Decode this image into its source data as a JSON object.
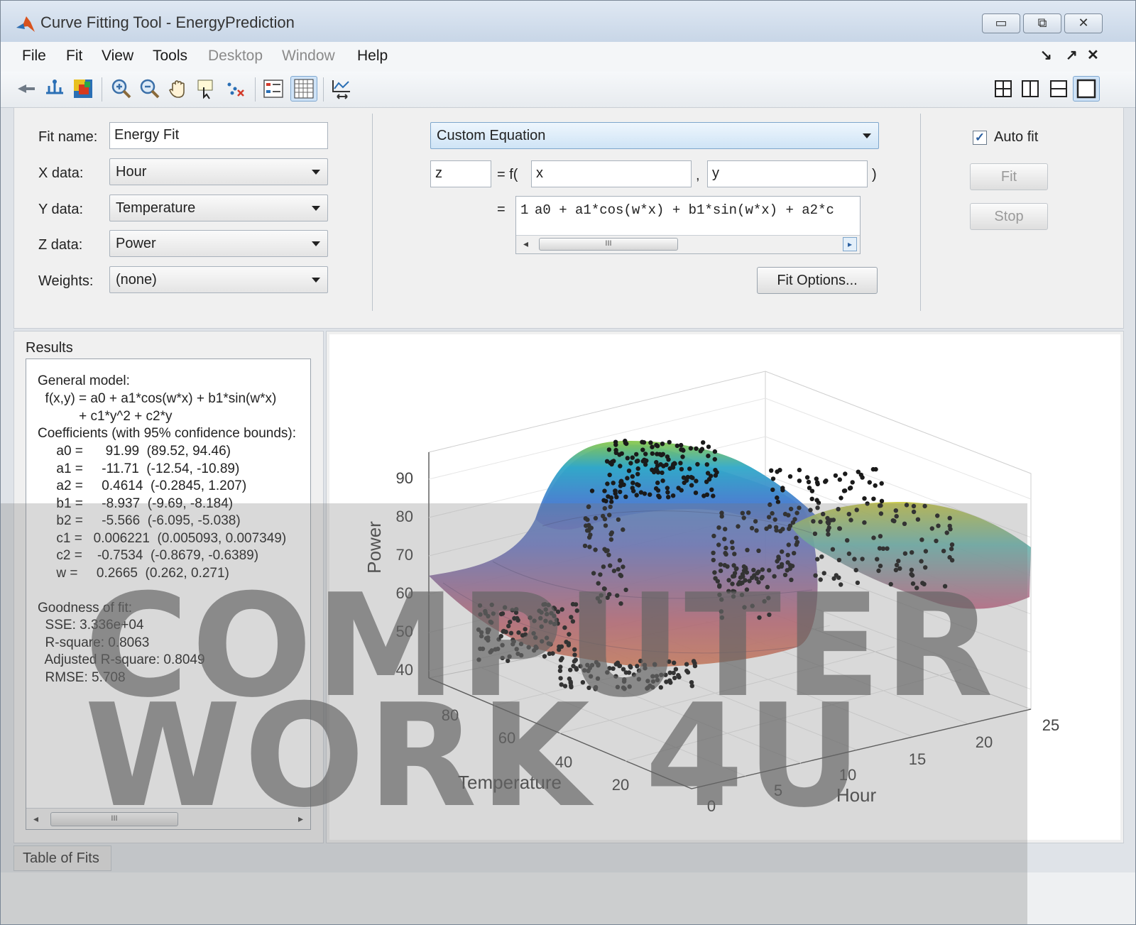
{
  "window": {
    "title": "Curve Fitting Tool - EnergyPrediction"
  },
  "menu": [
    "File",
    "Fit",
    "View",
    "Tools",
    "Desktop",
    "Window",
    "Help"
  ],
  "menu_disabled": [
    "Desktop",
    "Window"
  ],
  "fit": {
    "name_label": "Fit name:",
    "name_value": "Energy Fit",
    "x_label": "X data:",
    "x_value": "Hour",
    "y_label": "Y data:",
    "y_value": "Temperature",
    "z_label": "Z data:",
    "z_value": "Power",
    "weights_label": "Weights:",
    "weights_value": "(none)",
    "model_type": "Custom Equation",
    "z_var": "z",
    "eq_prefix": "= f(",
    "x_var": "x",
    "comma": ",",
    "y_var": "y",
    "close_paren": ")",
    "equals": "=",
    "line_number": "1",
    "equation": "a0 + a1*cos(w*x) + b1*sin(w*x) + a2*c",
    "scroll_grip": "III",
    "fit_options": "Fit Options...",
    "auto_fit_label": "Auto fit",
    "auto_fit_checked": true,
    "fit_button": "Fit",
    "stop_button": "Stop"
  },
  "results": {
    "title": "Results",
    "lines": [
      "General model:",
      "  f(x,y) = a0 + a1*cos(w*x) + b1*sin(w*x)",
      "           + c1*y^2 + c2*y",
      "Coefficients (with 95% confidence bounds):",
      "     a0 =      91.99  (89.52, 94.46)",
      "     a1 =     -11.71  (-12.54, -10.89)",
      "     a2 =     0.4614  (-0.2845, 1.207)",
      "     b1 =     -8.937  (-9.69, -8.184)",
      "     b2 =     -5.566  (-6.095, -5.038)",
      "     c1 =   0.006221  (0.005093, 0.007349)",
      "     c2 =    -0.7534  (-0.8679, -0.6389)",
      "     w =     0.2665  (0.262, 0.271)",
      "",
      "Goodness of fit:",
      "  SSE: 3.336e+04",
      "  R-square: 0.8063",
      "  Adjusted R-square: 0.8049",
      "  RMSE: 5.708"
    ],
    "scroll_grip": "III"
  },
  "plot": {
    "zlabel": "Power",
    "xlabel": "Hour",
    "ylabel": "Temperature",
    "z_ticks": [
      "90",
      "80",
      "70",
      "60",
      "50",
      "40"
    ],
    "temp_ticks": [
      "80",
      "60",
      "40",
      "20"
    ],
    "hour_ticks": [
      "0",
      "5",
      "10",
      "15",
      "20",
      "25"
    ]
  },
  "bottom_tab": "Table of Fits",
  "watermark": {
    "line1": "COMPUTER",
    "line2": "WORK 4U"
  },
  "colors": {
    "accent": "#2a6fb5",
    "titlebar": "#c8d6e7",
    "panel": "#f0f0f0"
  }
}
